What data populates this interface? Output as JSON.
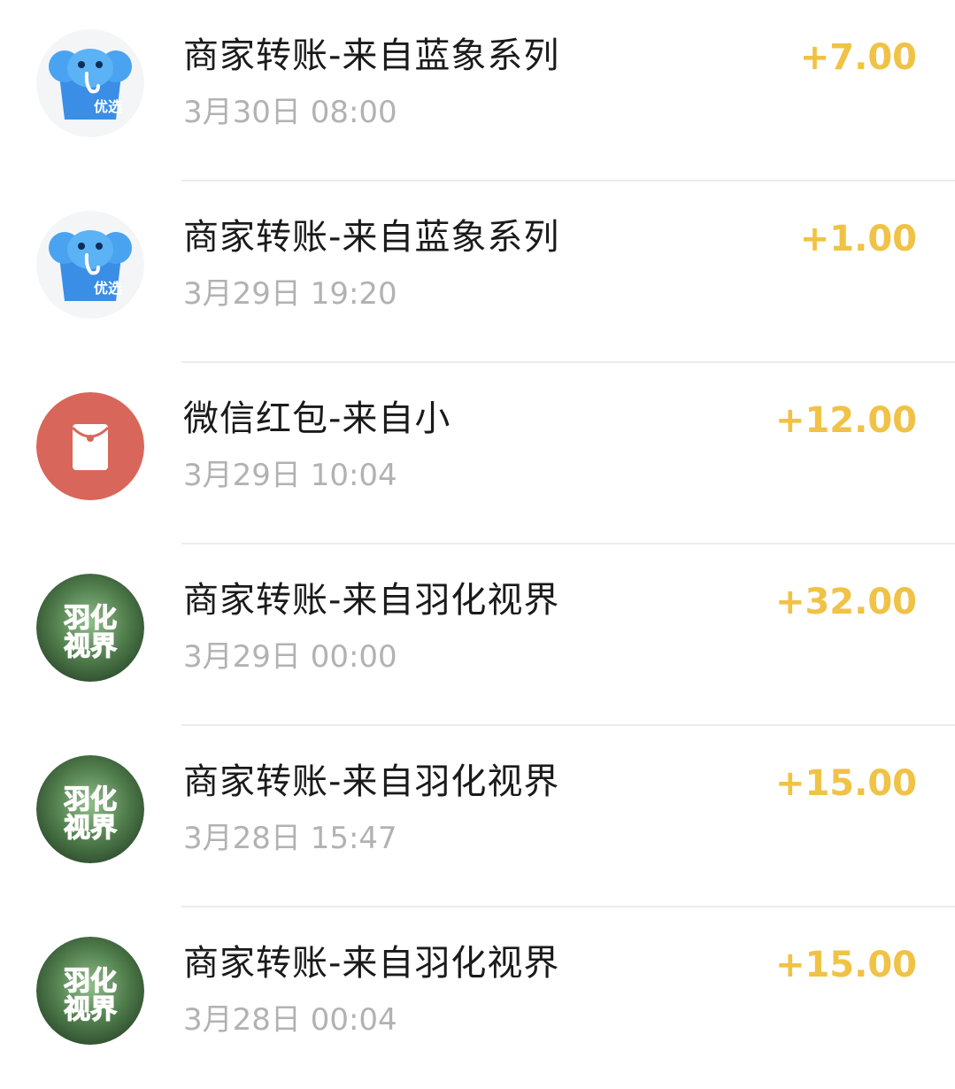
{
  "transactions": [
    {
      "title": "商家转账-来自蓝象系列",
      "time": "3月30日 08:00",
      "amount": "+7.00",
      "icon": "elephant-shop-icon",
      "badge": "优选"
    },
    {
      "title": "商家转账-来自蓝象系列",
      "time": "3月29日 19:20",
      "amount": "+1.00",
      "icon": "elephant-shop-icon",
      "badge": "优选"
    },
    {
      "title": "微信红包-来自小",
      "time": "3月29日 10:04",
      "amount": "+12.00",
      "icon": "red-packet-icon"
    },
    {
      "title": "商家转账-来自羽化视界",
      "time": "3月29日 00:00",
      "amount": "+32.00",
      "icon": "yuhua-avatar-icon",
      "badge_line1": "羽化",
      "badge_line2": "视界"
    },
    {
      "title": "商家转账-来自羽化视界",
      "time": "3月28日 15:47",
      "amount": "+15.00",
      "icon": "yuhua-avatar-icon",
      "badge_line1": "羽化",
      "badge_line2": "视界"
    },
    {
      "title": "商家转账-来自羽化视界",
      "time": "3月28日 00:04",
      "amount": "+15.00",
      "icon": "yuhua-avatar-icon",
      "badge_line1": "羽化",
      "badge_line2": "视界"
    }
  ],
  "colors": {
    "amount": "#f0c245",
    "title": "#1a1a1a",
    "time": "#b2b2b2",
    "divider": "#ececec",
    "red_packet": "#d9665a",
    "elephant_blue": "#3a8ee6"
  }
}
